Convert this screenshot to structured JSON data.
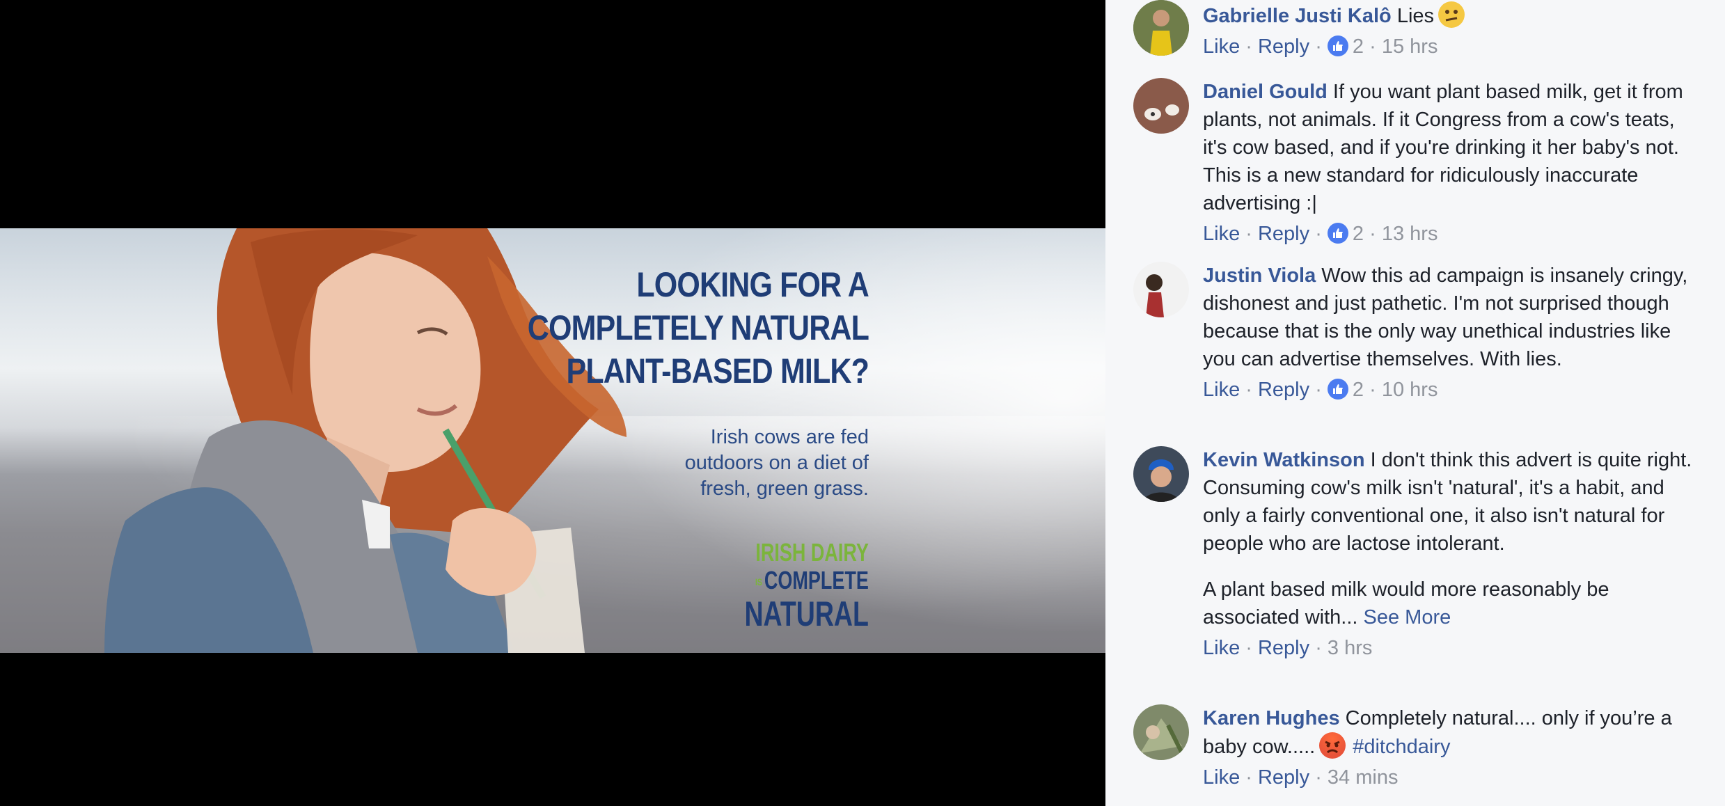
{
  "ad": {
    "headline": [
      "LOOKING FOR A",
      "COMPLETELY NATURAL",
      "PLANT-BASED MILK?"
    ],
    "subline": [
      "Irish cows are fed",
      "outdoors on a diet of",
      "fresh, green grass."
    ],
    "logo": {
      "line1": "IRISH DAIRY",
      "line2_small": "IS",
      "line2": "COMPLETE",
      "line3": "NATURAL"
    },
    "colors": {
      "headline": "#1f3d76",
      "logo_green": "#7bb43c"
    }
  },
  "comments": [
    {
      "author": "Gabrielle Justi Kalô",
      "text": "Lies",
      "emoji": "confused-face-icon",
      "actions": {
        "like": "Like",
        "reply": "Reply",
        "likes": "2",
        "time": "15 hrs"
      }
    },
    {
      "author": "Daniel Gould",
      "text": "If you want plant based milk, get it from plants, not animals. If it Congress from a cow's teats, it's cow based, and if you're drinking it her baby's not. This is a new standard for ridiculously inaccurate advertising :|",
      "actions": {
        "like": "Like",
        "reply": "Reply",
        "likes": "2",
        "time": "13 hrs"
      }
    },
    {
      "author": "Justin Viola",
      "text": "Wow this ad campaign is insanely cringy, dishonest and just pathetic. I'm not surprised though because that is the only way unethical industries like you can advertise themselves. With lies.",
      "actions": {
        "like": "Like",
        "reply": "Reply",
        "likes": "2",
        "time": "10 hrs"
      }
    },
    {
      "author": "Kevin Watkinson",
      "text": "I don't think this advert is quite right. Consuming cow's milk isn't 'natural', it's a habit, and only a fairly conventional one, it also isn't natural for people who are lactose intolerant.",
      "text2": "A plant based milk would more reasonably be associated with...",
      "see_more": "See More",
      "actions": {
        "like": "Like",
        "reply": "Reply",
        "time": "3 hrs"
      }
    },
    {
      "author": "Karen Hughes",
      "text": "Completely natural.... only if you’re a baby cow.....",
      "emoji": "angry-face-icon",
      "hashtag": "#ditchdairy",
      "actions": {
        "like": "Like",
        "reply": "Reply",
        "time": "34 mins"
      }
    }
  ],
  "separator": " · "
}
